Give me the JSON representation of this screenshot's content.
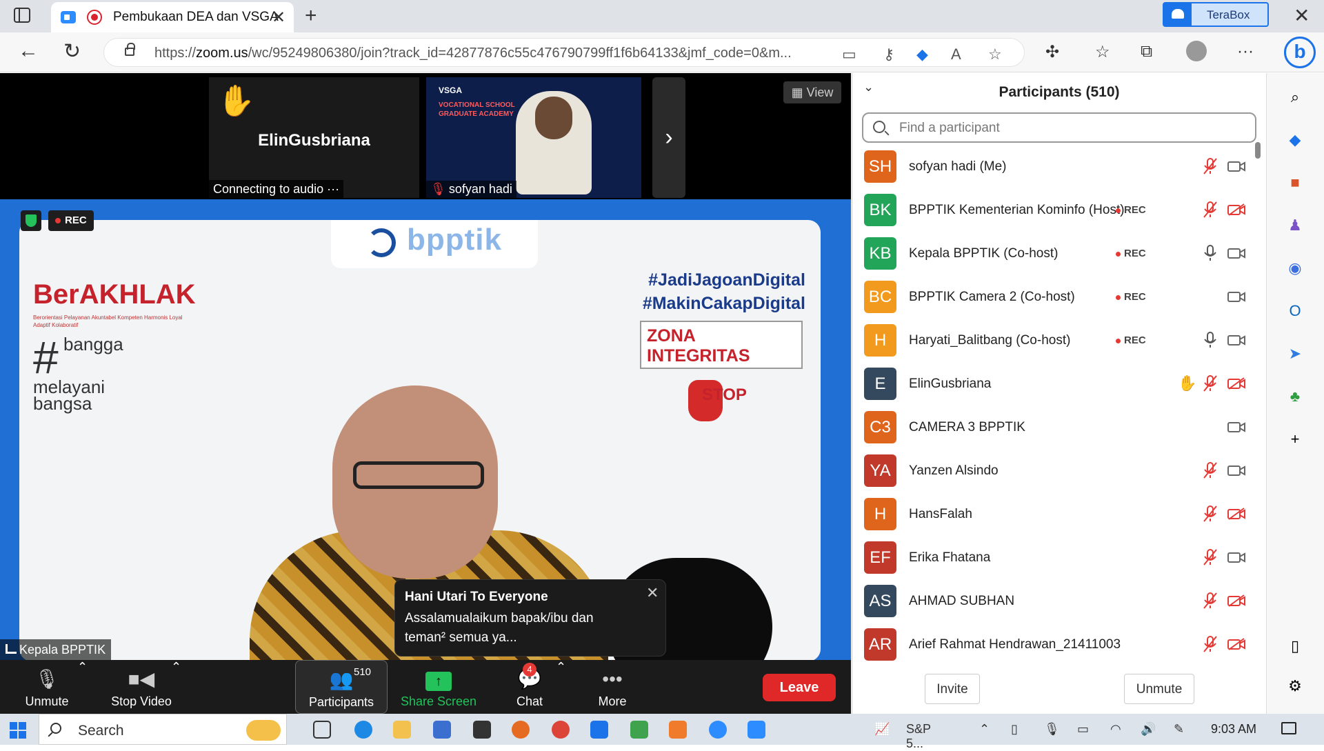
{
  "browser": {
    "tab_title": "Pembukaan DEA dan VSGA",
    "new_tab_label": "+",
    "terabox_label": "TeraBox",
    "url_domain": "zoom.us",
    "url_prefix": "https://",
    "url_rest": "/wc/95249806380/join?track_id=42877876c55c476790799ff1f6b64133&jmf_code=0&m..."
  },
  "meeting": {
    "view_label": "View",
    "tile1_name": "ElinGusbriana",
    "tile1_status": "Connecting to audio ···",
    "tile2_name": "sofyan hadi",
    "tile2_slide_title": "VSGA",
    "tile2_slide_subtitle": "VOCATIONAL SCHOOL GRADUATE ACADEMY",
    "rec_label": "REC",
    "speaker_label": "Kepala BPPTIK",
    "slide": {
      "logo_text": "bpptik",
      "berakhlak": "BerAKHLAK",
      "berakhlak_sub": "Berorientasi Pelayanan Akuntabel Kompeten Harmonis Loyal Adaptif Kolaboratif",
      "bangga_1": "bangga",
      "bangga_2": "melayani",
      "bangga_3": "bangsa",
      "tag1": "#JadiJagoanDigital",
      "tag2": "#MakinCakapDigital",
      "zona": "ZONA INTEGRITAS",
      "stop": "STOP"
    },
    "chat_popup": {
      "from": "Hani Utari To Everyone",
      "message": "Assalamualaikum bapak/ibu dan teman² semua ya..."
    }
  },
  "toolbar": {
    "unmute": "Unmute",
    "stop_video": "Stop Video",
    "participants": "Participants",
    "participants_count": "510",
    "share_screen": "Share Screen",
    "chat": "Chat",
    "chat_badge": "4",
    "more": "More",
    "leave": "Leave"
  },
  "panel": {
    "title": "Participants (510)",
    "search_placeholder": "Find a participant",
    "invite": "Invite",
    "unmute": "Unmute",
    "participants": [
      {
        "initials": "SH",
        "name": "sofyan hadi (Me)",
        "color": "#e0651c",
        "rec": "",
        "hand": false,
        "mic": "muted",
        "cam": "on"
      },
      {
        "initials": "BK",
        "name": "BPPTIK Kementerian Kominfo (Host)",
        "color": "#23a559",
        "rec": "REC",
        "hand": false,
        "mic": "muted",
        "cam": "off"
      },
      {
        "initials": "KB",
        "name": "Kepala BPPTIK (Co-host)",
        "color": "#23a559",
        "rec": "REC",
        "hand": false,
        "mic": "on",
        "cam": "on"
      },
      {
        "initials": "BC",
        "name": "BPPTIK Camera 2 (Co-host)",
        "color": "#f29a1d",
        "rec": "REC",
        "hand": false,
        "mic": "none",
        "cam": "on"
      },
      {
        "initials": "H",
        "name": "Haryati_Balitbang (Co-host)",
        "color": "#f29a1d",
        "rec": "REC",
        "hand": false,
        "mic": "on",
        "cam": "on"
      },
      {
        "initials": "E",
        "name": "ElinGusbriana",
        "color": "#34495e",
        "rec": "",
        "hand": true,
        "mic": "muted",
        "cam": "off"
      },
      {
        "initials": "C3",
        "name": "CAMERA 3 BPPTIK",
        "color": "#e0651c",
        "rec": "",
        "hand": false,
        "mic": "none",
        "cam": "on"
      },
      {
        "initials": "YA",
        "name": "Yanzen Alsindo",
        "color": "#c0392b",
        "rec": "",
        "hand": false,
        "mic": "muted",
        "cam": "on"
      },
      {
        "initials": "H",
        "name": "HansFalah",
        "color": "#e0651c",
        "rec": "",
        "hand": false,
        "mic": "muted",
        "cam": "off"
      },
      {
        "initials": "EF",
        "name": "Erika Fhatana",
        "color": "#c0392b",
        "rec": "",
        "hand": false,
        "mic": "muted",
        "cam": "on"
      },
      {
        "initials": "AS",
        "name": "AHMAD SUBHAN",
        "color": "#34495e",
        "rec": "",
        "hand": false,
        "mic": "muted",
        "cam": "off"
      },
      {
        "initials": "AR",
        "name": "Arief Rahmat Hendrawan_21411003",
        "color": "#c0392b",
        "rec": "",
        "hand": false,
        "mic": "muted",
        "cam": "off"
      }
    ]
  },
  "taskbar": {
    "search_label": "Search",
    "stock_label": "S&P 5...",
    "time": "9:03 AM"
  }
}
